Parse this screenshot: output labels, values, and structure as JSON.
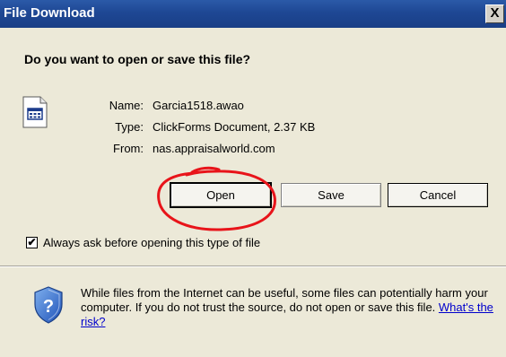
{
  "window": {
    "title": "File Download",
    "close_label": "X"
  },
  "dialog": {
    "question": "Do you want to open or save this file?",
    "file": {
      "icon": "clickforms-document-icon",
      "name_label": "Name:",
      "name_value": "Garcia1518.awao",
      "type_label": "Type:",
      "type_value": "ClickForms Document, 2.37 KB",
      "from_label": "From:",
      "from_value": "nas.appraisalworld.com"
    },
    "buttons": {
      "open": "Open",
      "save": "Save",
      "cancel": "Cancel"
    },
    "checkbox": {
      "label": "Always ask before opening this type of file",
      "checked": true,
      "mark": "✔"
    },
    "warning": {
      "icon": "security-shield-icon",
      "text": "While files from the Internet can be useful, some files can potentially harm your computer. If you do not trust the source, do not open or save this file.",
      "link": "What's the risk?"
    }
  },
  "colors": {
    "titlebar": "#1e4794",
    "background": "#ece9d8",
    "annotation": "#e8141a",
    "link": "#0000cc"
  }
}
